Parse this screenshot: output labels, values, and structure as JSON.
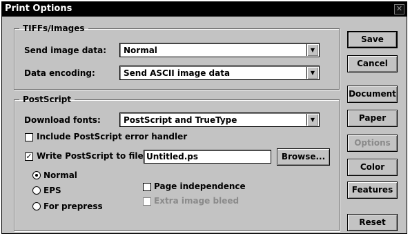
{
  "window": {
    "title": "Print Options"
  },
  "tiffs_group": {
    "title": "TIFFs/Images",
    "send_image_data_label": "Send image data:",
    "send_image_data_value": "Normal",
    "data_encoding_label": "Data encoding:",
    "data_encoding_value": "Send ASCII image data"
  },
  "postscript_group": {
    "title": "PostScript",
    "download_fonts_label": "Download fonts:",
    "download_fonts_value": "PostScript and TrueType",
    "include_error_handler_label": "Include PostScript error handler",
    "include_error_handler_checked": false,
    "write_to_file_label": "Write PostScript to file:",
    "write_to_file_checked": true,
    "filename_value": "Untitled.ps",
    "browse_label": "Browse...",
    "radio_normal_label": "Normal",
    "radio_eps_label": "EPS",
    "radio_prepress_label": "For prepress",
    "selected_radio": "Normal",
    "page_independence_label": "Page independence",
    "extra_image_bleed_label": "Extra image bleed"
  },
  "buttons": {
    "save": "Save",
    "cancel": "Cancel",
    "document": "Document",
    "paper": "Paper",
    "options": "Options",
    "color": "Color",
    "features": "Features",
    "reset": "Reset"
  },
  "colors": {
    "dialog_face": "#c3c3c3",
    "titlebar": "#000000",
    "disabled_text": "#8a8a8a"
  }
}
